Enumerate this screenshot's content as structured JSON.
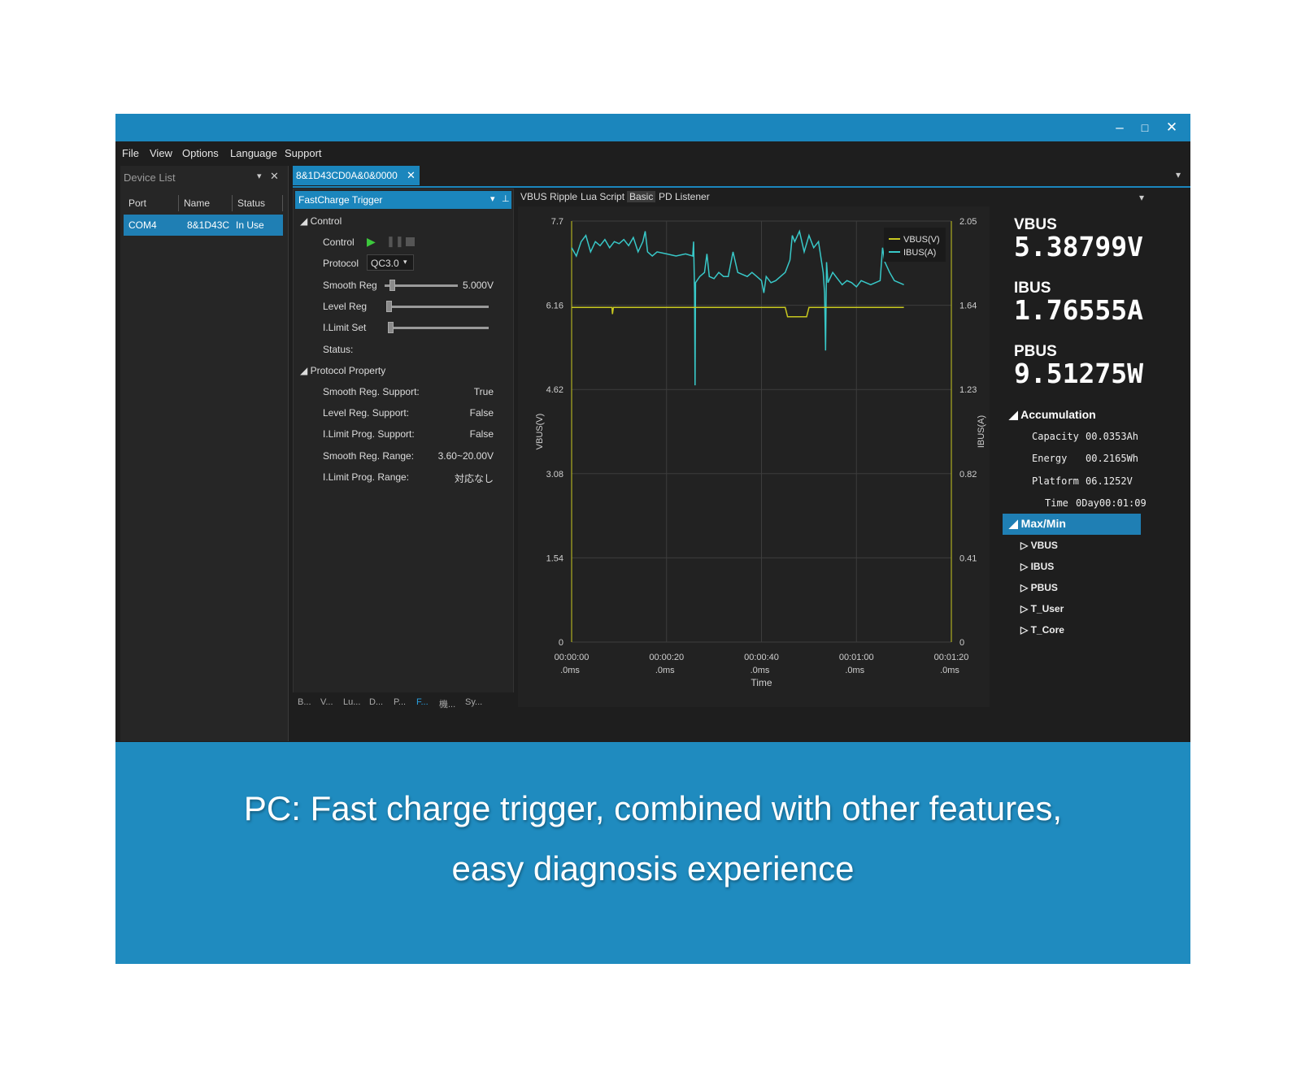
{
  "window": {
    "controls": {
      "minimize": "–",
      "maximize": "□",
      "close": "✕"
    }
  },
  "menu": [
    "File",
    "View",
    "Options",
    "Language",
    "Support"
  ],
  "device_list": {
    "title": "Device List",
    "columns": [
      "Port",
      "Name",
      "Status"
    ],
    "rows": [
      {
        "port": "COM4",
        "name": "8&1D43C",
        "status": "In Use"
      }
    ]
  },
  "document_tab": {
    "label": "8&1D43CD0A&0&0000"
  },
  "fastcharge": {
    "title": "FastCharge Trigger",
    "control_section": "Control",
    "control_label": "Control",
    "protocol_label": "Protocol",
    "protocol_value": "QC3.0",
    "smooth_reg_label": "Smooth Reg",
    "smooth_reg_value": "5.000V",
    "level_reg_label": "Level Reg",
    "ilimit_set_label": "I.Limit Set",
    "status_label": "Status:",
    "property_section": "Protocol Property",
    "properties": [
      {
        "label": "Smooth Reg. Support:",
        "value": "True"
      },
      {
        "label": "Level Reg. Support:",
        "value": "False"
      },
      {
        "label": "I.Limit Prog. Support:",
        "value": "False"
      },
      {
        "label": "Smooth Reg. Range:",
        "value": "3.60~20.00V"
      },
      {
        "label": "I.Limit Prog. Range:",
        "value": "対応なし"
      }
    ]
  },
  "bottom_tabs": [
    "B...",
    "V...",
    "Lu...",
    "D...",
    "P...",
    "F...",
    "機...",
    "Sy..."
  ],
  "right_tabs": [
    "VBUS Ripple",
    "Lua Script",
    "Basic",
    "PD Listener"
  ],
  "chart_data": {
    "type": "line",
    "xlabel": "Time",
    "ylabel_left": "VBUS(V)",
    "ylabel_right": "IBUS(A)",
    "x_ticks": [
      "00:00:00\n.0ms",
      "00:00:20\n.0ms",
      "00:00:40\n.0ms",
      "00:01:00\n.0ms",
      "00:01:20\n.0ms"
    ],
    "x_range_s": [
      0,
      80
    ],
    "y_left_ticks": [
      "0",
      "1.54",
      "3.08",
      "4.62",
      "6.16",
      "7.7"
    ],
    "y_left_range": [
      0,
      7.7
    ],
    "y_right_ticks": [
      "0",
      "0.41",
      "0.82",
      "1.23",
      "1.64",
      "2.05"
    ],
    "y_right_range": [
      0,
      2.05
    ],
    "legend": [
      "VBUS(V)",
      "IBUS(A)"
    ],
    "legend_position": "top-right",
    "colors": {
      "vbus": "#c8c820",
      "ibus": "#38c8c8"
    },
    "grid": true,
    "series": [
      {
        "name": "VBUS(V)",
        "axis": "left",
        "points": [
          [
            0,
            6.12
          ],
          [
            8.5,
            6.12
          ],
          [
            8.6,
            6.0
          ],
          [
            8.8,
            6.12
          ],
          [
            45,
            6.12
          ],
          [
            45.5,
            5.95
          ],
          [
            49.5,
            5.95
          ],
          [
            50,
            6.12
          ],
          [
            70,
            6.12
          ]
        ]
      },
      {
        "name": "IBUS(A)",
        "axis": "right",
        "points": [
          [
            0,
            1.92
          ],
          [
            1,
            1.88
          ],
          [
            2,
            1.95
          ],
          [
            3,
            1.98
          ],
          [
            4,
            1.9
          ],
          [
            5,
            1.95
          ],
          [
            6,
            1.93
          ],
          [
            7,
            1.96
          ],
          [
            8,
            1.92
          ],
          [
            9,
            1.95
          ],
          [
            10,
            1.94
          ],
          [
            11,
            1.96
          ],
          [
            12,
            1.93
          ],
          [
            13,
            1.97
          ],
          [
            14,
            1.9
          ],
          [
            15,
            1.95
          ],
          [
            15.5,
            2.0
          ],
          [
            16,
            1.9
          ],
          [
            17,
            1.88
          ],
          [
            18,
            1.9
          ],
          [
            20,
            1.89
          ],
          [
            22,
            1.88
          ],
          [
            24,
            1.89
          ],
          [
            25.5,
            1.88
          ],
          [
            25.7,
            1.95
          ],
          [
            25.9,
            1.7
          ],
          [
            26,
            1.25
          ],
          [
            26.1,
            1.75
          ],
          [
            27,
            1.78
          ],
          [
            28,
            1.8
          ],
          [
            28.5,
            1.89
          ],
          [
            29,
            1.78
          ],
          [
            30,
            1.77
          ],
          [
            31,
            1.8
          ],
          [
            32,
            1.78
          ],
          [
            33,
            1.78
          ],
          [
            34,
            1.9
          ],
          [
            35,
            1.8
          ],
          [
            36,
            1.79
          ],
          [
            37,
            1.78
          ],
          [
            38,
            1.8
          ],
          [
            39,
            1.78
          ],
          [
            40,
            1.76
          ],
          [
            40.5,
            1.7
          ],
          [
            41,
            1.78
          ],
          [
            42,
            1.75
          ],
          [
            43,
            1.76
          ],
          [
            44,
            1.78
          ],
          [
            45,
            1.8
          ],
          [
            46,
            1.86
          ],
          [
            46.5,
            1.98
          ],
          [
            47,
            1.95
          ],
          [
            48,
            2.0
          ],
          [
            49,
            1.9
          ],
          [
            50,
            1.98
          ],
          [
            51,
            1.92
          ],
          [
            52,
            1.95
          ],
          [
            53,
            1.8
          ],
          [
            53.3,
            1.7
          ],
          [
            53.5,
            1.42
          ],
          [
            53.7,
            1.85
          ],
          [
            54,
            1.75
          ],
          [
            55,
            1.8
          ],
          [
            56,
            1.77
          ],
          [
            57,
            1.74
          ],
          [
            58,
            1.76
          ],
          [
            59,
            1.75
          ],
          [
            60,
            1.73
          ],
          [
            61,
            1.76
          ],
          [
            62,
            1.75
          ],
          [
            63,
            1.74
          ],
          [
            64,
            1.75
          ],
          [
            65,
            1.76
          ],
          [
            65.5,
            1.92
          ],
          [
            66,
            1.85
          ],
          [
            67,
            1.8
          ],
          [
            68,
            1.76
          ],
          [
            69,
            1.75
          ],
          [
            70,
            1.74
          ]
        ]
      }
    ]
  },
  "readouts": {
    "vbus_label": "VBUS",
    "vbus_value": "5.38799V",
    "ibus_label": "IBUS",
    "ibus_value": "1.76555A",
    "pbus_label": "PBUS",
    "pbus_value": "9.51275W",
    "accumulation_label": "Accumulation",
    "accumulation": [
      {
        "label": "Capacity",
        "value": "00.0353Ah"
      },
      {
        "label": "Energy",
        "value": "00.2165Wh"
      },
      {
        "label": "Platform",
        "value": "06.1252V"
      },
      {
        "label": "Time",
        "value": "0Day00:01:09"
      }
    ],
    "maxmin_label": "Max/Min",
    "maxmin_items": [
      "VBUS",
      "IBUS",
      "PBUS",
      "T_User",
      "T_Core"
    ]
  },
  "caption": {
    "line1": "PC: Fast charge trigger, combined with other features,",
    "line2": "easy diagnosis experience"
  }
}
